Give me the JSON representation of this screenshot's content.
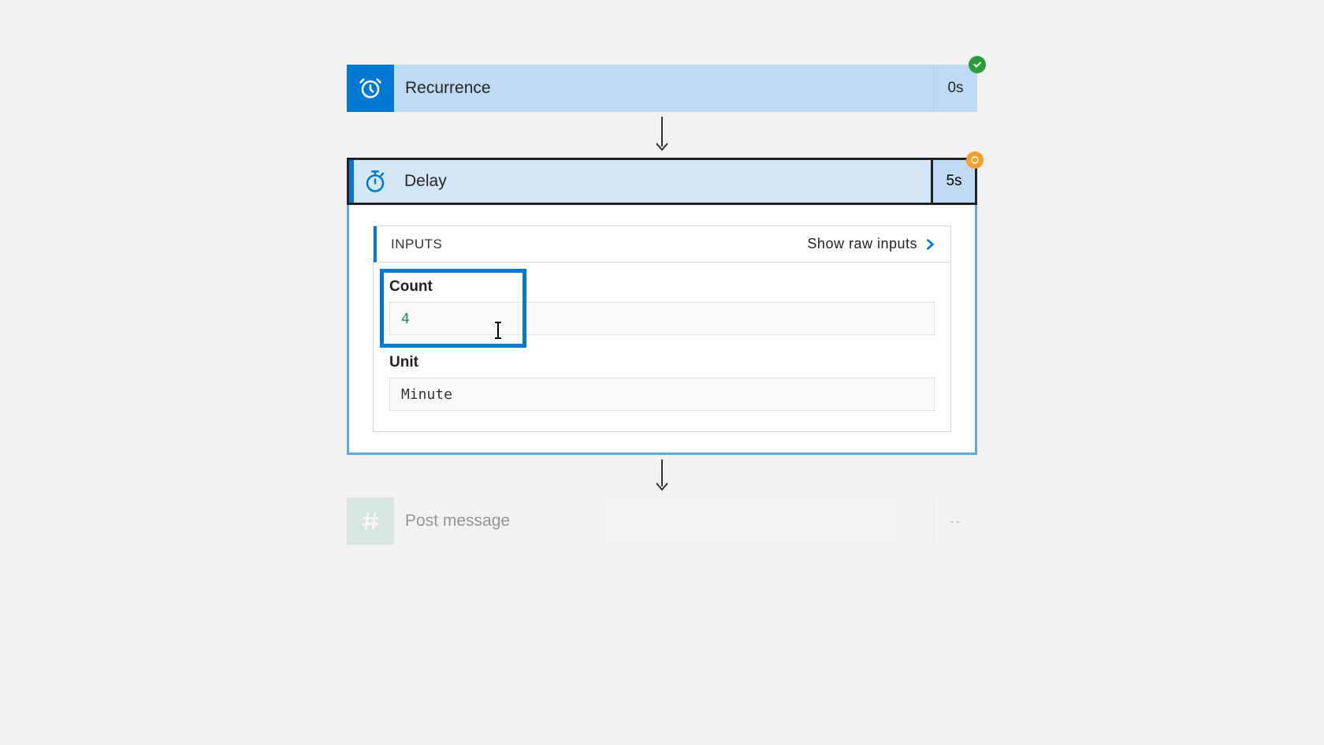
{
  "recurrence": {
    "title": "Recurrence",
    "duration": "0s",
    "status": "success"
  },
  "delay": {
    "title": "Delay",
    "duration": "5s",
    "status": "running",
    "inputs_heading": "INPUTS",
    "show_raw_label": "Show raw inputs",
    "fields": {
      "count_label": "Count",
      "count_value": "4",
      "unit_label": "Unit",
      "unit_value": "Minute"
    }
  },
  "post_message": {
    "title": "Post message",
    "duration": "--"
  }
}
